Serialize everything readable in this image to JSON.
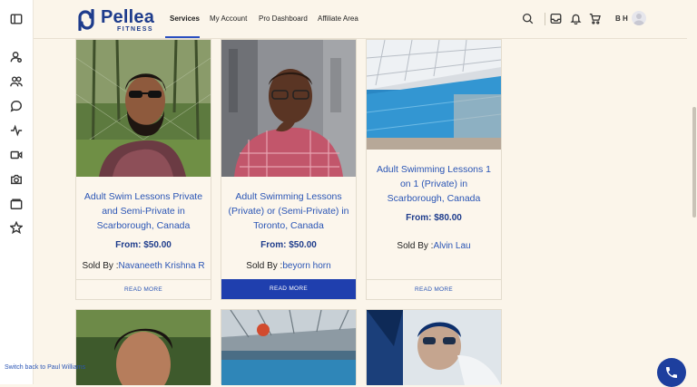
{
  "brand": {
    "name": "Pellea",
    "sub": "FITNESS",
    "color": "#1e3c8c"
  },
  "rail": {
    "icons": [
      "sidebar-toggle-icon",
      "user-icon",
      "users-icon",
      "chat-icon",
      "activity-icon",
      "video-icon",
      "camera-icon",
      "folder-icon",
      "star-icon"
    ]
  },
  "nav": {
    "items": [
      {
        "label": "Services",
        "active": true
      },
      {
        "label": "My Account"
      },
      {
        "label": "Pro Dashboard"
      },
      {
        "label": "Affiliate Area"
      }
    ]
  },
  "header": {
    "icons": [
      "search-icon",
      "inbox-icon",
      "bell-icon",
      "cart-icon"
    ],
    "initials": "B H"
  },
  "products": [
    {
      "title": "Adult Swim Lessons Private and Semi-Private in Scarborough, Canada",
      "price": "From: $50.00",
      "seller_label": "Sold By :",
      "seller": "Navaneeth Krishna R",
      "more": "READ MORE"
    },
    {
      "title": "Adult Swimming Lessons (Private) or (Semi-Private) in Toronto, Canada",
      "price": "From: $50.00",
      "seller_label": "Sold By :",
      "seller": "beyorn horn",
      "more": "READ MORE"
    },
    {
      "title": "Adult Swimming Lessons 1 on 1 (Private) in Scarborough, Canada",
      "price": "From: $80.00",
      "seller_label": "Sold By :",
      "seller": "Alvin Lau",
      "more": "READ MORE"
    }
  ],
  "footer": {
    "switch_back": "Switch back to Paul Williams"
  },
  "colors": {
    "accent": "#1f3fae",
    "link": "#2a55b5",
    "background": "#fbf5ea"
  }
}
